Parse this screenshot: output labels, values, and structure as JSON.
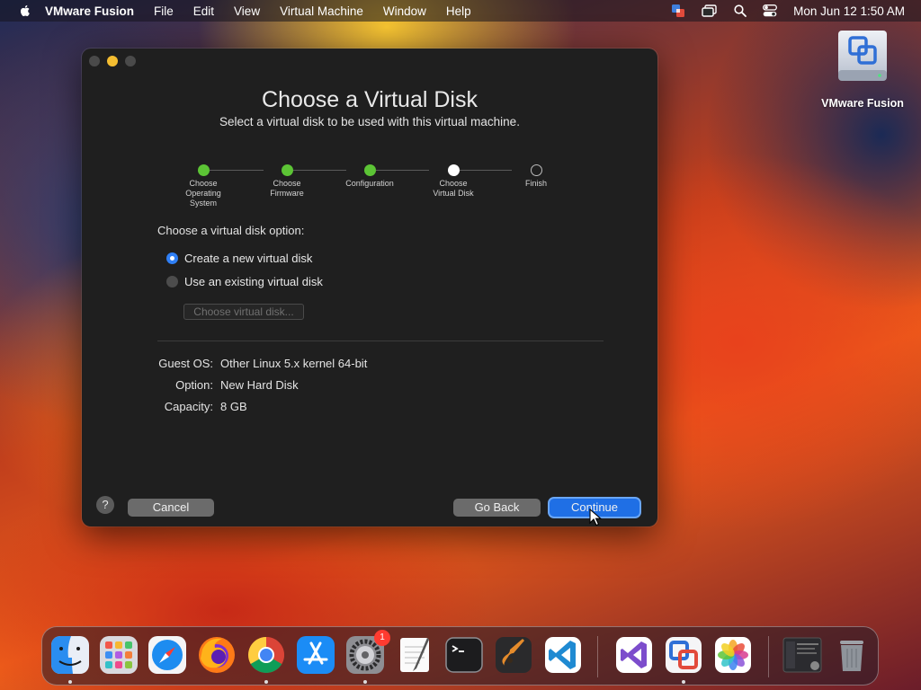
{
  "menubar": {
    "app_name": "VMware Fusion",
    "items": [
      "File",
      "Edit",
      "View",
      "Virtual Machine",
      "Window",
      "Help"
    ],
    "clock": "Mon Jun 12  1:50 AM"
  },
  "desktop": {
    "icon_label": "VMware Fusion"
  },
  "dialog": {
    "title": "Choose a Virtual Disk",
    "subtitle": "Select a virtual disk to be used with this virtual machine.",
    "steps": [
      {
        "label": "Choose Operating System",
        "state": "done"
      },
      {
        "label": "Choose Firmware",
        "state": "done"
      },
      {
        "label": "Configuration",
        "state": "done"
      },
      {
        "label": "Choose Virtual Disk",
        "state": "current"
      },
      {
        "label": "Finish",
        "state": "todo"
      }
    ],
    "option_heading": "Choose a virtual disk option:",
    "options": [
      {
        "label": "Create a new virtual disk",
        "selected": true
      },
      {
        "label": "Use an existing virtual disk",
        "selected": false
      }
    ],
    "choose_disk_button": "Choose virtual disk...",
    "info": [
      {
        "key": "Guest OS:",
        "value": "Other Linux 5.x kernel 64-bit"
      },
      {
        "key": "Option:",
        "value": "New Hard Disk"
      },
      {
        "key": "Capacity:",
        "value": "8 GB"
      }
    ],
    "help_label": "?",
    "cancel_label": "Cancel",
    "back_label": "Go Back",
    "continue_label": "Continue"
  },
  "dock": {
    "apps": [
      "finder-icon",
      "launchpad-icon",
      "safari-icon",
      "firefox-icon",
      "chrome-icon",
      "app-store-icon",
      "system-settings-icon",
      "textedit-icon",
      "terminal-icon",
      "garageband-icon",
      "vscode-icon",
      "visual-studio-icon",
      "vmware-fusion-icon",
      "photos-icon",
      "downloads-stack-icon",
      "trash-icon"
    ],
    "settings_badge": "1"
  },
  "colors": {
    "accent": "#1f6fe5",
    "step_done": "#5cc435",
    "window_bg": "#1f1f1f"
  }
}
